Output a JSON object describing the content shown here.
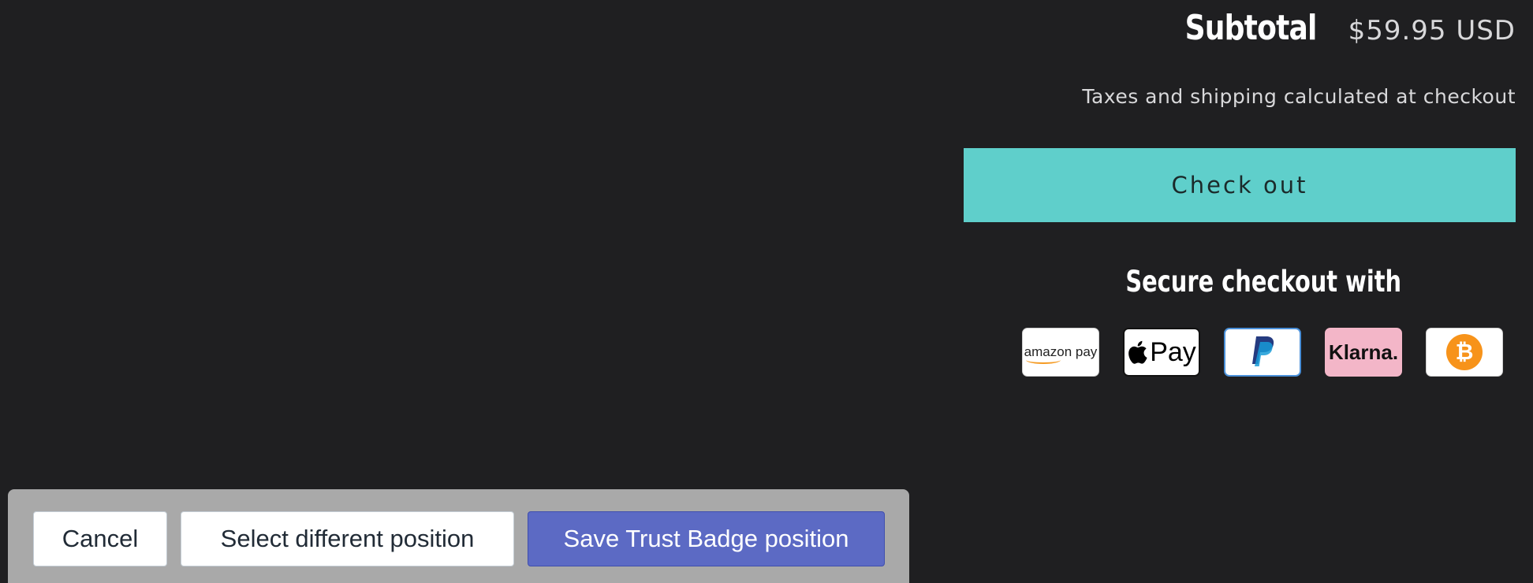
{
  "cart": {
    "subtotal_label": "Subtotal",
    "subtotal_value": "$59.95 USD",
    "tax_note": "Taxes and shipping calculated at checkout",
    "checkout_label": "Check out"
  },
  "trust": {
    "heading": "Secure checkout with",
    "badges": [
      {
        "name": "amazon pay",
        "text_a": "amazon",
        "text_b": "pay"
      },
      {
        "name": "Apple Pay",
        "text": "Pay"
      },
      {
        "name": "PayPal",
        "text": "P"
      },
      {
        "name": "Klarna",
        "text": "Klarna."
      },
      {
        "name": "Bitcoin",
        "text": "₿"
      }
    ]
  },
  "toolbar": {
    "cancel_label": "Cancel",
    "select_label": "Select different position",
    "save_label": "Save Trust Badge position"
  },
  "colors": {
    "background": "#1f1f21",
    "checkout": "#5fcfcb",
    "save": "#5c6ac4",
    "toolbar": "#a9a9a9"
  }
}
